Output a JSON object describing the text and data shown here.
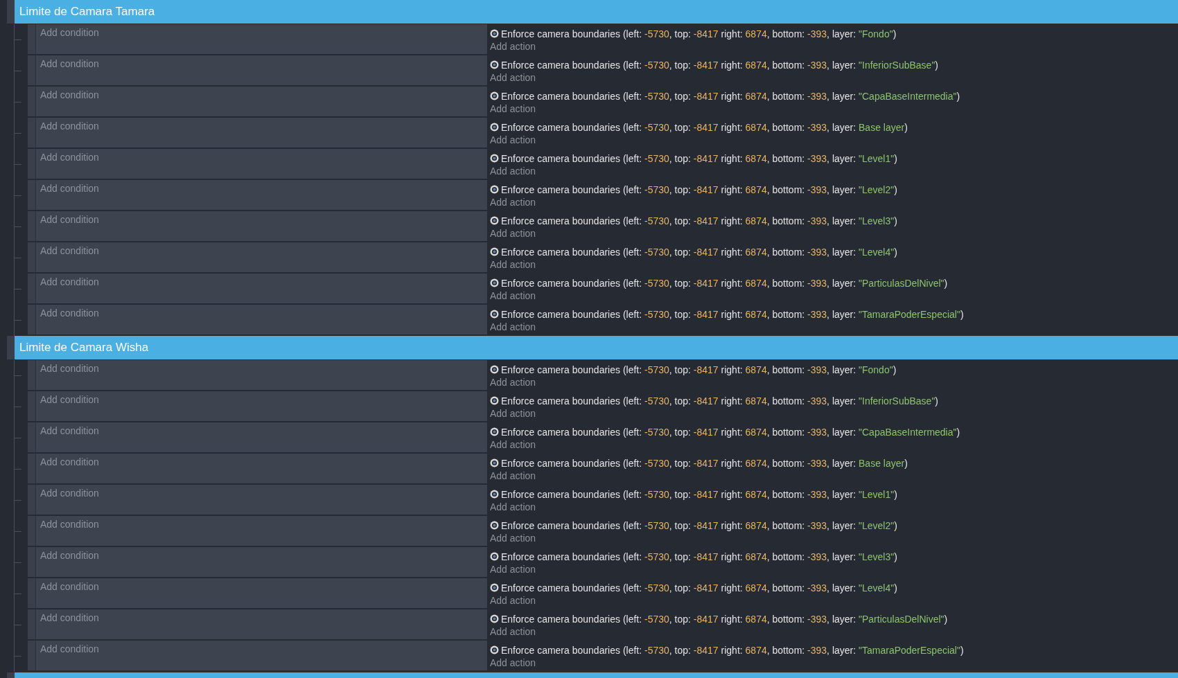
{
  "groups": [
    {
      "title": "Limite de Camara Tamara",
      "events": [
        {
          "condition": "Add condition",
          "add_action": "Add action",
          "action": [
            {
              "kind": "plain",
              "text": "Enforce camera boundaries (left: "
            },
            {
              "kind": "number",
              "text": "-5730"
            },
            {
              "kind": "plain",
              "text": ", top: "
            },
            {
              "kind": "number",
              "text": "-8417"
            },
            {
              "kind": "plain",
              "text": " right: "
            },
            {
              "kind": "number",
              "text": "6874"
            },
            {
              "kind": "plain",
              "text": ", bottom: "
            },
            {
              "kind": "number",
              "text": "-393"
            },
            {
              "kind": "plain",
              "text": ", layer: "
            },
            {
              "kind": "string",
              "text": "\"Fondo\""
            },
            {
              "kind": "plain",
              "text": ")"
            }
          ]
        },
        {
          "condition": "Add condition",
          "add_action": "Add action",
          "action": [
            {
              "kind": "plain",
              "text": "Enforce camera boundaries (left: "
            },
            {
              "kind": "number",
              "text": "-5730"
            },
            {
              "kind": "plain",
              "text": ", top: "
            },
            {
              "kind": "number",
              "text": "-8417"
            },
            {
              "kind": "plain",
              "text": " right: "
            },
            {
              "kind": "number",
              "text": "6874"
            },
            {
              "kind": "plain",
              "text": ", bottom: "
            },
            {
              "kind": "number",
              "text": "-393"
            },
            {
              "kind": "plain",
              "text": ", layer: "
            },
            {
              "kind": "string",
              "text": "\"InferiorSubBase\""
            },
            {
              "kind": "plain",
              "text": ")"
            }
          ]
        },
        {
          "condition": "Add condition",
          "add_action": "Add action",
          "action": [
            {
              "kind": "plain",
              "text": "Enforce camera boundaries (left: "
            },
            {
              "kind": "number",
              "text": "-5730"
            },
            {
              "kind": "plain",
              "text": ", top: "
            },
            {
              "kind": "number",
              "text": "-8417"
            },
            {
              "kind": "plain",
              "text": " right: "
            },
            {
              "kind": "number",
              "text": "6874"
            },
            {
              "kind": "plain",
              "text": ", bottom: "
            },
            {
              "kind": "number",
              "text": "-393"
            },
            {
              "kind": "plain",
              "text": ", layer: "
            },
            {
              "kind": "string",
              "text": "\"CapaBaseIntermedia\""
            },
            {
              "kind": "plain",
              "text": ")"
            }
          ]
        },
        {
          "condition": "Add condition",
          "add_action": "Add action",
          "action": [
            {
              "kind": "plain",
              "text": "Enforce camera boundaries (left: "
            },
            {
              "kind": "number",
              "text": "-5730"
            },
            {
              "kind": "plain",
              "text": ", top: "
            },
            {
              "kind": "number",
              "text": "-8417"
            },
            {
              "kind": "plain",
              "text": " right: "
            },
            {
              "kind": "number",
              "text": "6874"
            },
            {
              "kind": "plain",
              "text": ", bottom: "
            },
            {
              "kind": "number",
              "text": "-393"
            },
            {
              "kind": "plain",
              "text": ", layer: "
            },
            {
              "kind": "string",
              "text": "Base layer"
            },
            {
              "kind": "plain",
              "text": ")"
            }
          ]
        },
        {
          "condition": "Add condition",
          "add_action": "Add action",
          "action": [
            {
              "kind": "plain",
              "text": "Enforce camera boundaries (left: "
            },
            {
              "kind": "number",
              "text": "-5730"
            },
            {
              "kind": "plain",
              "text": ", top: "
            },
            {
              "kind": "number",
              "text": "-8417"
            },
            {
              "kind": "plain",
              "text": " right: "
            },
            {
              "kind": "number",
              "text": "6874"
            },
            {
              "kind": "plain",
              "text": ", bottom: "
            },
            {
              "kind": "number",
              "text": "-393"
            },
            {
              "kind": "plain",
              "text": ", layer: "
            },
            {
              "kind": "string",
              "text": "\"Level1\""
            },
            {
              "kind": "plain",
              "text": ")"
            }
          ]
        },
        {
          "condition": "Add condition",
          "add_action": "Add action",
          "action": [
            {
              "kind": "plain",
              "text": "Enforce camera boundaries (left: "
            },
            {
              "kind": "number",
              "text": "-5730"
            },
            {
              "kind": "plain",
              "text": ", top: "
            },
            {
              "kind": "number",
              "text": "-8417"
            },
            {
              "kind": "plain",
              "text": " right: "
            },
            {
              "kind": "number",
              "text": "6874"
            },
            {
              "kind": "plain",
              "text": ", bottom: "
            },
            {
              "kind": "number",
              "text": "-393"
            },
            {
              "kind": "plain",
              "text": ", layer: "
            },
            {
              "kind": "string",
              "text": "\"Level2\""
            },
            {
              "kind": "plain",
              "text": ")"
            }
          ]
        },
        {
          "condition": "Add condition",
          "add_action": "Add action",
          "action": [
            {
              "kind": "plain",
              "text": "Enforce camera boundaries (left: "
            },
            {
              "kind": "number",
              "text": "-5730"
            },
            {
              "kind": "plain",
              "text": ", top: "
            },
            {
              "kind": "number",
              "text": "-8417"
            },
            {
              "kind": "plain",
              "text": " right: "
            },
            {
              "kind": "number",
              "text": "6874"
            },
            {
              "kind": "plain",
              "text": ", bottom: "
            },
            {
              "kind": "number",
              "text": "-393"
            },
            {
              "kind": "plain",
              "text": ", layer: "
            },
            {
              "kind": "string",
              "text": "\"Level3\""
            },
            {
              "kind": "plain",
              "text": ")"
            }
          ]
        },
        {
          "condition": "Add condition",
          "add_action": "Add action",
          "action": [
            {
              "kind": "plain",
              "text": "Enforce camera boundaries (left: "
            },
            {
              "kind": "number",
              "text": "-5730"
            },
            {
              "kind": "plain",
              "text": ", top: "
            },
            {
              "kind": "number",
              "text": "-8417"
            },
            {
              "kind": "plain",
              "text": " right: "
            },
            {
              "kind": "number",
              "text": "6874"
            },
            {
              "kind": "plain",
              "text": ", bottom: "
            },
            {
              "kind": "number",
              "text": "-393"
            },
            {
              "kind": "plain",
              "text": ", layer: "
            },
            {
              "kind": "string",
              "text": "\"Level4\""
            },
            {
              "kind": "plain",
              "text": ")"
            }
          ]
        },
        {
          "condition": "Add condition",
          "add_action": "Add action",
          "action": [
            {
              "kind": "plain",
              "text": "Enforce camera boundaries (left: "
            },
            {
              "kind": "number",
              "text": "-5730"
            },
            {
              "kind": "plain",
              "text": ", top: "
            },
            {
              "kind": "number",
              "text": "-8417"
            },
            {
              "kind": "plain",
              "text": " right: "
            },
            {
              "kind": "number",
              "text": "6874"
            },
            {
              "kind": "plain",
              "text": ", bottom: "
            },
            {
              "kind": "number",
              "text": "-393"
            },
            {
              "kind": "plain",
              "text": ", layer: "
            },
            {
              "kind": "string",
              "text": "\"ParticulasDelNivel\""
            },
            {
              "kind": "plain",
              "text": ")"
            }
          ]
        },
        {
          "condition": "Add condition",
          "add_action": "Add action",
          "action": [
            {
              "kind": "plain",
              "text": "Enforce camera boundaries (left: "
            },
            {
              "kind": "number",
              "text": "-5730"
            },
            {
              "kind": "plain",
              "text": ", top: "
            },
            {
              "kind": "number",
              "text": "-8417"
            },
            {
              "kind": "plain",
              "text": " right: "
            },
            {
              "kind": "number",
              "text": "6874"
            },
            {
              "kind": "plain",
              "text": ", bottom: "
            },
            {
              "kind": "number",
              "text": "-393"
            },
            {
              "kind": "plain",
              "text": ", layer: "
            },
            {
              "kind": "string",
              "text": "\"TamaraPoderEspecial\""
            },
            {
              "kind": "plain",
              "text": ")"
            }
          ]
        }
      ]
    },
    {
      "title": "Limite de Camara Wisha",
      "events": [
        {
          "condition": "Add condition",
          "add_action": "Add action",
          "action": [
            {
              "kind": "plain",
              "text": "Enforce camera boundaries (left: "
            },
            {
              "kind": "number",
              "text": "-5730"
            },
            {
              "kind": "plain",
              "text": ", top: "
            },
            {
              "kind": "number",
              "text": "-8417"
            },
            {
              "kind": "plain",
              "text": " right: "
            },
            {
              "kind": "number",
              "text": "6874"
            },
            {
              "kind": "plain",
              "text": ", bottom: "
            },
            {
              "kind": "number",
              "text": "-393"
            },
            {
              "kind": "plain",
              "text": ", layer: "
            },
            {
              "kind": "string",
              "text": "\"Fondo\""
            },
            {
              "kind": "plain",
              "text": ")"
            }
          ]
        },
        {
          "condition": "Add condition",
          "add_action": "Add action",
          "action": [
            {
              "kind": "plain",
              "text": "Enforce camera boundaries (left: "
            },
            {
              "kind": "number",
              "text": "-5730"
            },
            {
              "kind": "plain",
              "text": ", top: "
            },
            {
              "kind": "number",
              "text": "-8417"
            },
            {
              "kind": "plain",
              "text": " right: "
            },
            {
              "kind": "number",
              "text": "6874"
            },
            {
              "kind": "plain",
              "text": ", bottom: "
            },
            {
              "kind": "number",
              "text": "-393"
            },
            {
              "kind": "plain",
              "text": ", layer: "
            },
            {
              "kind": "string",
              "text": "\"InferiorSubBase\""
            },
            {
              "kind": "plain",
              "text": ")"
            }
          ]
        },
        {
          "condition": "Add condition",
          "add_action": "Add action",
          "action": [
            {
              "kind": "plain",
              "text": "Enforce camera boundaries (left: "
            },
            {
              "kind": "number",
              "text": "-5730"
            },
            {
              "kind": "plain",
              "text": ", top: "
            },
            {
              "kind": "number",
              "text": "-8417"
            },
            {
              "kind": "plain",
              "text": " right: "
            },
            {
              "kind": "number",
              "text": "6874"
            },
            {
              "kind": "plain",
              "text": ", bottom: "
            },
            {
              "kind": "number",
              "text": "-393"
            },
            {
              "kind": "plain",
              "text": ", layer: "
            },
            {
              "kind": "string",
              "text": "\"CapaBaseIntermedia\""
            },
            {
              "kind": "plain",
              "text": ")"
            }
          ]
        },
        {
          "condition": "Add condition",
          "add_action": "Add action",
          "action": [
            {
              "kind": "plain",
              "text": "Enforce camera boundaries (left: "
            },
            {
              "kind": "number",
              "text": "-5730"
            },
            {
              "kind": "plain",
              "text": ", top: "
            },
            {
              "kind": "number",
              "text": "-8417"
            },
            {
              "kind": "plain",
              "text": " right: "
            },
            {
              "kind": "number",
              "text": "6874"
            },
            {
              "kind": "plain",
              "text": ", bottom: "
            },
            {
              "kind": "number",
              "text": "-393"
            },
            {
              "kind": "plain",
              "text": ", layer: "
            },
            {
              "kind": "string",
              "text": "Base layer"
            },
            {
              "kind": "plain",
              "text": ")"
            }
          ]
        },
        {
          "condition": "Add condition",
          "add_action": "Add action",
          "action": [
            {
              "kind": "plain",
              "text": "Enforce camera boundaries (left: "
            },
            {
              "kind": "number",
              "text": "-5730"
            },
            {
              "kind": "plain",
              "text": ", top: "
            },
            {
              "kind": "number",
              "text": "-8417"
            },
            {
              "kind": "plain",
              "text": " right: "
            },
            {
              "kind": "number",
              "text": "6874"
            },
            {
              "kind": "plain",
              "text": ", bottom: "
            },
            {
              "kind": "number",
              "text": "-393"
            },
            {
              "kind": "plain",
              "text": ", layer: "
            },
            {
              "kind": "string",
              "text": "\"Level1\""
            },
            {
              "kind": "plain",
              "text": ")"
            }
          ]
        },
        {
          "condition": "Add condition",
          "add_action": "Add action",
          "action": [
            {
              "kind": "plain",
              "text": "Enforce camera boundaries (left: "
            },
            {
              "kind": "number",
              "text": "-5730"
            },
            {
              "kind": "plain",
              "text": ", top: "
            },
            {
              "kind": "number",
              "text": "-8417"
            },
            {
              "kind": "plain",
              "text": " right: "
            },
            {
              "kind": "number",
              "text": "6874"
            },
            {
              "kind": "plain",
              "text": ", bottom: "
            },
            {
              "kind": "number",
              "text": "-393"
            },
            {
              "kind": "plain",
              "text": ", layer: "
            },
            {
              "kind": "string",
              "text": "\"Level2\""
            },
            {
              "kind": "plain",
              "text": ")"
            }
          ]
        },
        {
          "condition": "Add condition",
          "add_action": "Add action",
          "action": [
            {
              "kind": "plain",
              "text": "Enforce camera boundaries (left: "
            },
            {
              "kind": "number",
              "text": "-5730"
            },
            {
              "kind": "plain",
              "text": ", top: "
            },
            {
              "kind": "number",
              "text": "-8417"
            },
            {
              "kind": "plain",
              "text": " right: "
            },
            {
              "kind": "number",
              "text": "6874"
            },
            {
              "kind": "plain",
              "text": ", bottom: "
            },
            {
              "kind": "number",
              "text": "-393"
            },
            {
              "kind": "plain",
              "text": ", layer: "
            },
            {
              "kind": "string",
              "text": "\"Level3\""
            },
            {
              "kind": "plain",
              "text": ")"
            }
          ]
        },
        {
          "condition": "Add condition",
          "add_action": "Add action",
          "action": [
            {
              "kind": "plain",
              "text": "Enforce camera boundaries (left: "
            },
            {
              "kind": "number",
              "text": "-5730"
            },
            {
              "kind": "plain",
              "text": ", top: "
            },
            {
              "kind": "number",
              "text": "-8417"
            },
            {
              "kind": "plain",
              "text": " right: "
            },
            {
              "kind": "number",
              "text": "6874"
            },
            {
              "kind": "plain",
              "text": ", bottom: "
            },
            {
              "kind": "number",
              "text": "-393"
            },
            {
              "kind": "plain",
              "text": ", layer: "
            },
            {
              "kind": "string",
              "text": "\"Level4\""
            },
            {
              "kind": "plain",
              "text": ")"
            }
          ]
        },
        {
          "condition": "Add condition",
          "add_action": "Add action",
          "action": [
            {
              "kind": "plain",
              "text": "Enforce camera boundaries (left: "
            },
            {
              "kind": "number",
              "text": "-5730"
            },
            {
              "kind": "plain",
              "text": ", top: "
            },
            {
              "kind": "number",
              "text": "-8417"
            },
            {
              "kind": "plain",
              "text": " right: "
            },
            {
              "kind": "number",
              "text": "6874"
            },
            {
              "kind": "plain",
              "text": ", bottom: "
            },
            {
              "kind": "number",
              "text": "-393"
            },
            {
              "kind": "plain",
              "text": ", layer: "
            },
            {
              "kind": "string",
              "text": "\"ParticulasDelNivel\""
            },
            {
              "kind": "plain",
              "text": ")"
            }
          ]
        },
        {
          "condition": "Add condition",
          "add_action": "Add action",
          "action": [
            {
              "kind": "plain",
              "text": "Enforce camera boundaries (left: "
            },
            {
              "kind": "number",
              "text": "-5730"
            },
            {
              "kind": "plain",
              "text": ", top: "
            },
            {
              "kind": "number",
              "text": "-8417"
            },
            {
              "kind": "plain",
              "text": " right: "
            },
            {
              "kind": "number",
              "text": "6874"
            },
            {
              "kind": "plain",
              "text": ", bottom: "
            },
            {
              "kind": "number",
              "text": "-393"
            },
            {
              "kind": "plain",
              "text": ", layer: "
            },
            {
              "kind": "string",
              "text": "\"TamaraPoderEspecial\""
            },
            {
              "kind": "plain",
              "text": ")"
            }
          ]
        }
      ]
    }
  ]
}
